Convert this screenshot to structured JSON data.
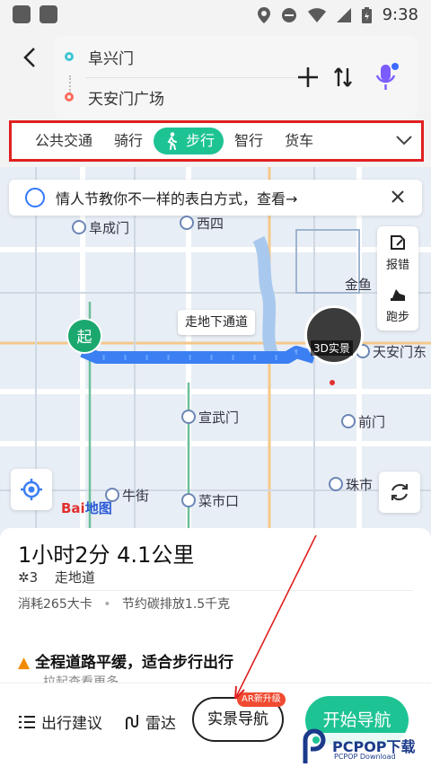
{
  "status_bar": {
    "time": "9:38"
  },
  "route": {
    "origin": "阜兴门",
    "destination": "天安门广场"
  },
  "tabs": [
    {
      "label": "公共交通"
    },
    {
      "label": "骑行"
    },
    {
      "label": "步行",
      "active": true
    },
    {
      "label": "智行"
    },
    {
      "label": "货车"
    }
  ],
  "banner": {
    "text": "情人节教你不一样的表白方式，查看→"
  },
  "side_panel": {
    "report_label": "报错",
    "run_label": "跑步"
  },
  "map": {
    "labels": {
      "fuchengmen": "阜成门",
      "xisi": "西四",
      "jinyu": "金鱼",
      "tiananmen_east": "天安门东",
      "xuanwumen": "宣武门",
      "qianmen": "前门",
      "niujie": "牛街",
      "caishikou": "菜市口",
      "zhushi": "珠市"
    },
    "start_pin": "起",
    "underpass_tag": "走地下通道",
    "threed_label": "3D实景",
    "baidu_logo": "Bai",
    "baidu_logo_suffix": "地图"
  },
  "summary": {
    "time_distance": "1小时2分  4.1公里",
    "lights": "3",
    "underpass": "走地道",
    "calories": "消耗265大卡",
    "carbon": "节约碳排放1.5千克",
    "notice": "全程道路平缓，适合步行出行",
    "notice_sub": "拉起查看更多"
  },
  "bottom_bar": {
    "advice": "出行建议",
    "radar": "雷达",
    "ar_nav": "实景导航",
    "ar_badge": "AR新升级",
    "start": "开始导航"
  },
  "watermark": {
    "text": "PCPOP下载",
    "sub": "PCPOP Download"
  },
  "colors": {
    "accent": "#1ec394",
    "route": "#3b7ff2",
    "highlight_box": "#e02020"
  }
}
